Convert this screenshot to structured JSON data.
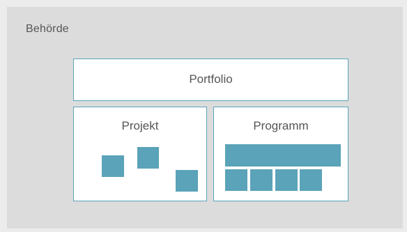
{
  "colors": {
    "accent": "#5aa3b9",
    "background": "#dcdcdd",
    "box": "#ffffff",
    "text": "#555555"
  },
  "agency": {
    "label": "Behörde"
  },
  "portfolio": {
    "label": "Portfolio"
  },
  "projekt": {
    "label": "Projekt",
    "square_count": 3
  },
  "programm": {
    "label": "Programm",
    "bar_count": 1,
    "square_count": 4
  }
}
